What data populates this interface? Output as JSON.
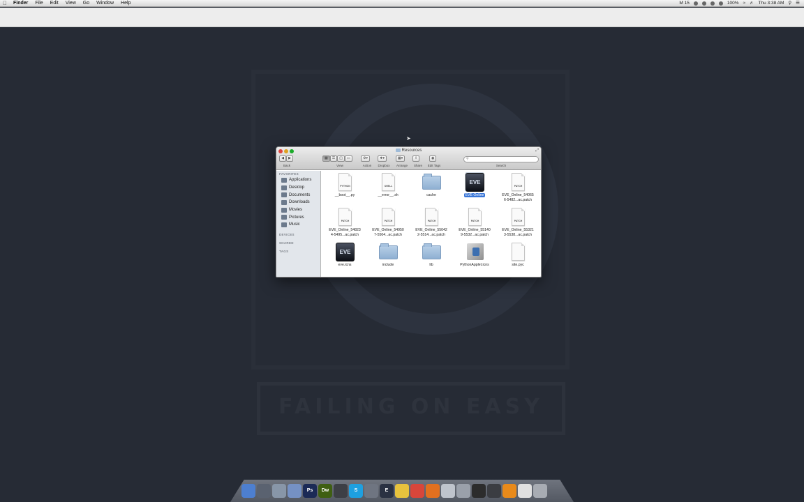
{
  "menubar": {
    "app_name": "Finder",
    "items": [
      "File",
      "Edit",
      "View",
      "Go",
      "Window",
      "Help"
    ],
    "status": [
      "M 15",
      "100%",
      "Thu 3:38 AM"
    ]
  },
  "wallpaper": {
    "text": "FAILING ON EASY"
  },
  "finder": {
    "title": "Resources",
    "toolbar": {
      "back_label": "Back",
      "view_label": "View",
      "action_label": "Action",
      "dropbox_label": "Dropbox",
      "arrange_label": "Arrange",
      "share_label": "Share",
      "edit_tags_label": "Edit Tags",
      "search_label": "Search",
      "search_placeholder": ""
    },
    "sidebar": {
      "favorites_heading": "FAVORITES",
      "items": [
        "Applications",
        "Desktop",
        "Documents",
        "Downloads",
        "Movies",
        "Pictures",
        "Music"
      ],
      "devices_heading": "DEVICES",
      "shared_heading": "SHARED",
      "tags_heading": "TAGS"
    },
    "files": [
      {
        "name": "__boot__.py",
        "kind": "doc",
        "tag": "PYTHON"
      },
      {
        "name": "__error__.sh",
        "kind": "doc",
        "tag": "SHELL"
      },
      {
        "name": "cache",
        "kind": "folder",
        "tag": ""
      },
      {
        "name": "EVE Online",
        "kind": "app",
        "tag": "EVE",
        "selected": true
      },
      {
        "name": "EVE_Online_54065\n6-5482...ac.patch",
        "kind": "doc",
        "tag": "PATCH"
      },
      {
        "name": "EVE_Online_54823\n4-5495...ac.patch",
        "kind": "doc",
        "tag": "PATCH"
      },
      {
        "name": "EVE_Online_54950\n7-5504...ac.patch",
        "kind": "doc",
        "tag": "PATCH"
      },
      {
        "name": "EVE_Online_55042\n2-5514...ac.patch",
        "kind": "doc",
        "tag": "PATCH"
      },
      {
        "name": "EVE_Online_55140\n9-5532...ac.patch",
        "kind": "doc",
        "tag": "PATCH"
      },
      {
        "name": "EVE_Online_55321\n3-5538...ac.patch",
        "kind": "doc",
        "tag": "PATCH"
      },
      {
        "name": "eve.icns",
        "kind": "app",
        "tag": "EVE"
      },
      {
        "name": "include",
        "kind": "folder",
        "tag": ""
      },
      {
        "name": "lib",
        "kind": "folder",
        "tag": ""
      },
      {
        "name": "PythonApplet.icns",
        "kind": "pyapp",
        "tag": ""
      },
      {
        "name": "site.pyc",
        "kind": "doc",
        "tag": ""
      }
    ]
  },
  "dock": {
    "icons": [
      {
        "name": "finder-icon",
        "color": "#4d7fd0",
        "glyph": ""
      },
      {
        "name": "dashboard-icon",
        "color": "#5a6270",
        "glyph": ""
      },
      {
        "name": "launchpad-icon",
        "color": "#8896a8",
        "glyph": ""
      },
      {
        "name": "preview-icon",
        "color": "#7591c4",
        "glyph": ""
      },
      {
        "name": "photoshop-icon",
        "color": "#1b2a56",
        "glyph": "Ps"
      },
      {
        "name": "dreamweaver-icon",
        "color": "#3f5f12",
        "glyph": "Dw"
      },
      {
        "name": "mission-control-icon",
        "color": "#3d3f45",
        "glyph": ""
      },
      {
        "name": "skype-icon",
        "color": "#1ea0e0",
        "glyph": "S"
      },
      {
        "name": "steam-icon",
        "color": "#6f7581",
        "glyph": ""
      },
      {
        "name": "eve-dock-icon",
        "color": "#2a3142",
        "glyph": "E"
      },
      {
        "name": "cyberduck-icon",
        "color": "#e7c23d",
        "glyph": ""
      },
      {
        "name": "chrome-icon",
        "color": "#d8463b",
        "glyph": ""
      },
      {
        "name": "firefox-icon",
        "color": "#e2701f",
        "glyph": ""
      },
      {
        "name": "mail-icon",
        "color": "#bfc4cc",
        "glyph": ""
      },
      {
        "name": "utility-icon",
        "color": "#9aa0aa",
        "glyph": ""
      },
      {
        "name": "obs-icon",
        "color": "#2c2c2c",
        "glyph": ""
      },
      {
        "name": "terminal-icon",
        "color": "#3b3d42",
        "glyph": ""
      },
      {
        "name": "vlc-icon",
        "color": "#e98a1a",
        "glyph": ""
      },
      {
        "name": "document-icon",
        "color": "#e0e0e0",
        "glyph": ""
      },
      {
        "name": "trash-icon",
        "color": "#a8acb3",
        "glyph": ""
      }
    ]
  }
}
